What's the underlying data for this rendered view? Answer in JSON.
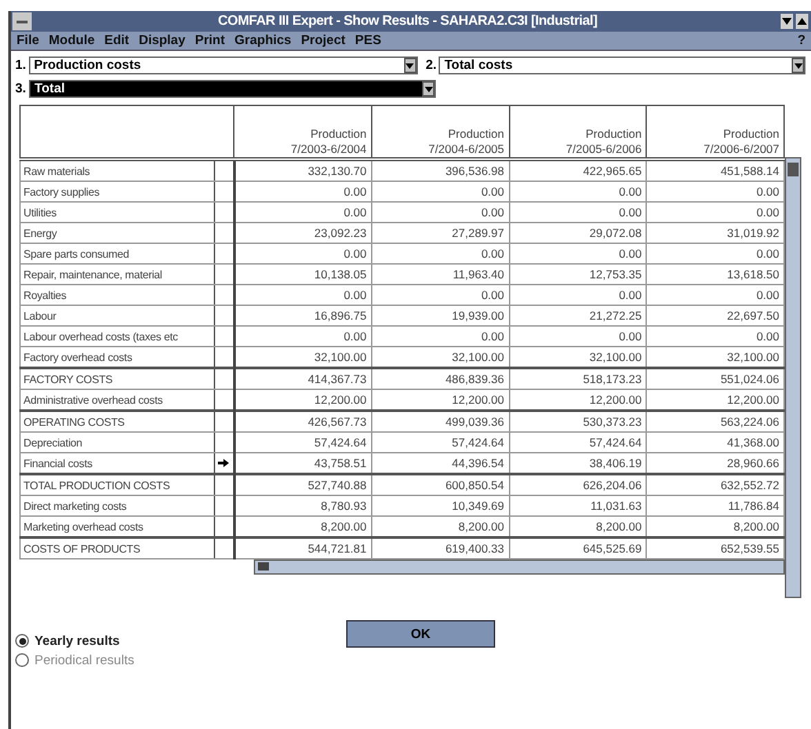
{
  "window": {
    "title": "COMFAR III Expert - Show Results - SAHARA2.C3I [Industrial]"
  },
  "menu": [
    "File",
    "Module",
    "Edit",
    "Display",
    "Print",
    "Graphics",
    "Project",
    "PES"
  ],
  "help": "?",
  "selectors": [
    {
      "number": "1.",
      "value": "Production costs",
      "selected": false
    },
    {
      "number": "2.",
      "value": "Total costs",
      "selected": false
    },
    {
      "number": "3.",
      "value": "Total",
      "selected": true
    }
  ],
  "table": {
    "columns": [
      [
        "Production",
        "7/2003-6/2004"
      ],
      [
        "Production",
        "7/2004-6/2005"
      ],
      [
        "Production",
        "7/2005-6/2006"
      ],
      [
        "Production",
        "7/2006-6/2007"
      ]
    ],
    "rows": [
      {
        "label": "Raw materials",
        "kind": "item",
        "marked": false,
        "values": [
          "332,130.70",
          "396,536.98",
          "422,965.65",
          "451,588.14"
        ]
      },
      {
        "label": "Factory supplies",
        "kind": "item",
        "marked": false,
        "values": [
          "0.00",
          "0.00",
          "0.00",
          "0.00"
        ]
      },
      {
        "label": "Utilities",
        "kind": "item",
        "marked": false,
        "values": [
          "0.00",
          "0.00",
          "0.00",
          "0.00"
        ]
      },
      {
        "label": "Energy",
        "kind": "item",
        "marked": false,
        "values": [
          "23,092.23",
          "27,289.97",
          "29,072.08",
          "31,019.92"
        ]
      },
      {
        "label": "Spare parts consumed",
        "kind": "item",
        "marked": false,
        "values": [
          "0.00",
          "0.00",
          "0.00",
          "0.00"
        ]
      },
      {
        "label": "Repair, maintenance, material",
        "kind": "item",
        "marked": false,
        "values": [
          "10,138.05",
          "11,963.40",
          "12,753.35",
          "13,618.50"
        ]
      },
      {
        "label": "Royalties",
        "kind": "item",
        "marked": false,
        "values": [
          "0.00",
          "0.00",
          "0.00",
          "0.00"
        ]
      },
      {
        "label": "Labour",
        "kind": "item",
        "marked": false,
        "values": [
          "16,896.75",
          "19,939.00",
          "21,272.25",
          "22,697.50"
        ]
      },
      {
        "label": "Labour overhead costs (taxes etc",
        "kind": "item",
        "marked": false,
        "values": [
          "0.00",
          "0.00",
          "0.00",
          "0.00"
        ]
      },
      {
        "label": "Factory overhead costs",
        "kind": "item",
        "marked": false,
        "values": [
          "32,100.00",
          "32,100.00",
          "32,100.00",
          "32,100.00"
        ]
      },
      {
        "label": "FACTORY COSTS",
        "kind": "total",
        "marked": false,
        "values": [
          "414,367.73",
          "486,839.36",
          "518,173.23",
          "551,024.06"
        ]
      },
      {
        "label": "Administrative overhead costs",
        "kind": "item",
        "marked": false,
        "values": [
          "12,200.00",
          "12,200.00",
          "12,200.00",
          "12,200.00"
        ]
      },
      {
        "label": "OPERATING COSTS",
        "kind": "total",
        "marked": false,
        "values": [
          "426,567.73",
          "499,039.36",
          "530,373.23",
          "563,224.06"
        ]
      },
      {
        "label": "Depreciation",
        "kind": "item",
        "marked": false,
        "values": [
          "57,424.64",
          "57,424.64",
          "57,424.64",
          "41,368.00"
        ]
      },
      {
        "label": "Financial costs",
        "kind": "item",
        "marked": true,
        "values": [
          "43,758.51",
          "44,396.54",
          "38,406.19",
          "28,960.66"
        ]
      },
      {
        "label": "TOTAL PRODUCTION COSTS",
        "kind": "total",
        "marked": false,
        "values": [
          "527,740.88",
          "600,850.54",
          "626,204.06",
          "632,552.72"
        ]
      },
      {
        "label": "Direct marketing costs",
        "kind": "item",
        "marked": false,
        "values": [
          "8,780.93",
          "10,349.69",
          "11,031.63",
          "11,786.84"
        ]
      },
      {
        "label": "Marketing overhead costs",
        "kind": "item",
        "marked": false,
        "values": [
          "8,200.00",
          "8,200.00",
          "8,200.00",
          "8,200.00"
        ]
      },
      {
        "label": "COSTS OF PRODUCTS",
        "kind": "total",
        "marked": false,
        "values": [
          "544,721.81",
          "619,400.33",
          "645,525.69",
          "652,539.55"
        ]
      }
    ]
  },
  "options": [
    {
      "label": "Yearly results",
      "selected": true
    },
    {
      "label": "Periodical results",
      "selected": false
    }
  ],
  "ok_button": "OK"
}
